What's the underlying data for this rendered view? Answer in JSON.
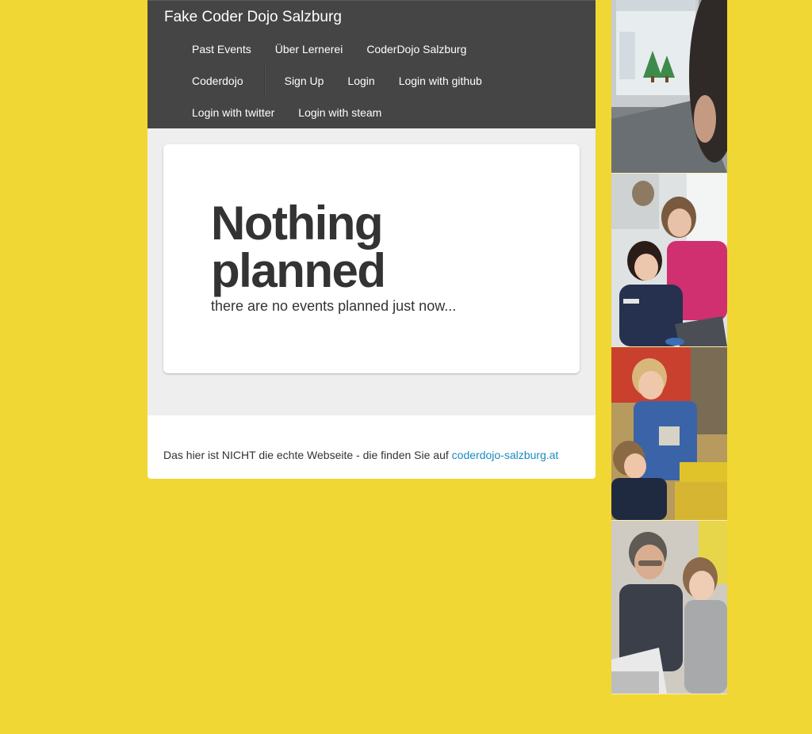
{
  "brand": "Fake Coder Dojo Salzburg",
  "nav": {
    "past_events": "Past Events",
    "lernerei": "Über Lernerei",
    "coderdojo_salzburg": "CoderDojo Salzburg",
    "coderdojo": "Coderdojo",
    "sign_up": "Sign Up",
    "login": "Login",
    "login_github": "Login with github",
    "login_twitter": "Login with twitter",
    "login_steam": "Login with steam"
  },
  "hero": {
    "title": "Nothing planned",
    "subtitle": "there are no events planned just now..."
  },
  "footer": {
    "text": "Das hier ist NICHT die echte Webseite - die finden Sie auf ",
    "link": "coderdojo-salzburg.at"
  },
  "colors": {
    "background": "#f0d733",
    "navbar": "#454545",
    "link": "#1a8bc0"
  }
}
